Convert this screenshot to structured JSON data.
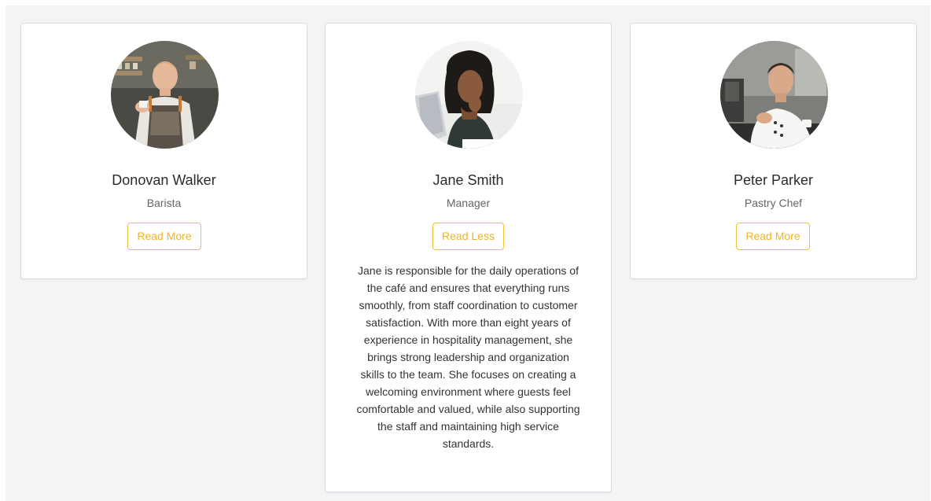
{
  "team": [
    {
      "name": "Donovan Walker",
      "role": "Barista",
      "button_label": "Read More",
      "photo": "barista-photo"
    },
    {
      "name": "Jane Smith",
      "role": "Manager",
      "button_label": "Read Less",
      "photo": "manager-photo",
      "bio": "Jane is responsible for the daily operations of the café and ensures that everything runs smoothly, from staff coordination to customer satisfaction. With more than eight years of experience in hospitality management, she brings strong leadership and organization skills to the team. She focuses on creating a welcoming environment where guests feel comfortable and valued, while also supporting the staff and maintaining high service standards."
    },
    {
      "name": "Peter Parker",
      "role": "Pastry Chef",
      "button_label": "Read More",
      "photo": "chef-photo"
    }
  ],
  "colors": {
    "accent": "#f0b323",
    "background": "#f3f4f6",
    "card": "#ffffff"
  }
}
